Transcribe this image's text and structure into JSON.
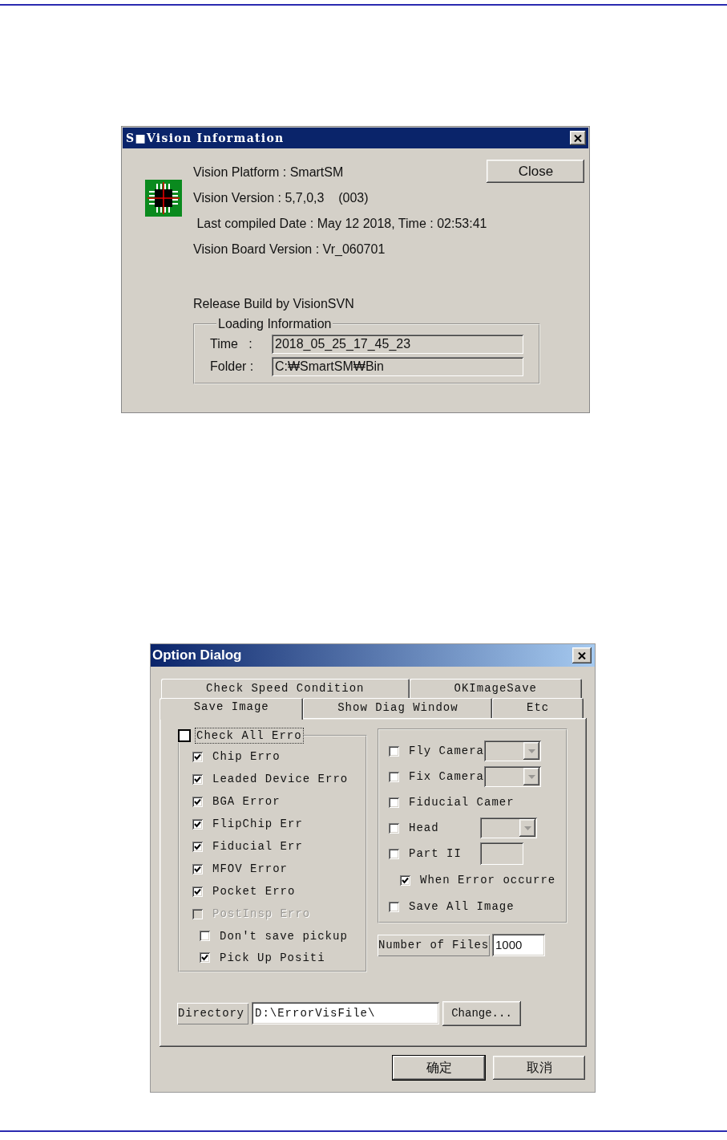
{
  "info_dialog": {
    "title": "S■Vision Information",
    "close_button": "Close",
    "lines": [
      "Vision Platform : SmartSM",
      "Vision Version : 5,7,0,3    (003)",
      " Last compiled Date : May 12 2018, Time : 02:53:41",
      "Vision Board Version : Vr_060701"
    ],
    "release_note": "Release Build by VisionSVN",
    "loading": {
      "title": "Loading Information",
      "fields": [
        {
          "label": "Time   :",
          "value": "2018_05_25_17_45_23"
        },
        {
          "label": "Folder :",
          "value": "C:₩SmartSM₩Bin"
        }
      ]
    }
  },
  "option_dialog": {
    "title": "Option Dialog",
    "tab_rows": [
      {
        "tabs": [
          {
            "label": "Check Speed Condition",
            "selected": false
          },
          {
            "label": "OKImageSave",
            "selected": false
          }
        ]
      },
      {
        "tabs": [
          {
            "label": "Save Image",
            "selected": true
          },
          {
            "label": "Show Diag Window",
            "selected": false
          },
          {
            "label": "Etc",
            "selected": false
          }
        ]
      }
    ],
    "error_group": {
      "check_all": {
        "label": "Check All Erro",
        "checked": false
      },
      "items": [
        {
          "label": "Chip Erro",
          "checked": true,
          "disabled": false,
          "kind": "main"
        },
        {
          "label": "Leaded Device Erro",
          "checked": true,
          "disabled": false,
          "kind": "main"
        },
        {
          "label": "BGA Error",
          "checked": true,
          "disabled": false,
          "kind": "main"
        },
        {
          "label": "FlipChip Err",
          "checked": true,
          "disabled": false,
          "kind": "main"
        },
        {
          "label": "Fiducial Err",
          "checked": true,
          "disabled": false,
          "kind": "main"
        },
        {
          "label": "MFOV Error",
          "checked": true,
          "disabled": false,
          "kind": "main"
        },
        {
          "label": "Pocket Erro",
          "checked": true,
          "disabled": false,
          "kind": "main"
        },
        {
          "label": "PostInsp Erro",
          "checked": false,
          "disabled": true,
          "kind": "main"
        },
        {
          "label": "Don't save pickup",
          "checked": false,
          "disabled": false,
          "kind": "sub"
        },
        {
          "label": "Pick Up Positi",
          "checked": true,
          "disabled": false,
          "kind": "sub"
        }
      ]
    },
    "camera_group": {
      "items": [
        {
          "label": "Fly Camera",
          "checked": false,
          "kind": "combo"
        },
        {
          "label": "Fix Camera",
          "checked": false,
          "kind": "combo"
        },
        {
          "label": "Fiducial Camer",
          "checked": false,
          "kind": "plain"
        },
        {
          "label": "Head",
          "checked": false,
          "kind": "combo"
        },
        {
          "label": "Part II",
          "checked": false,
          "kind": "field"
        },
        {
          "label": "When Error occurre",
          "checked": true,
          "kind": "sub"
        },
        {
          "label": "Save All Image",
          "checked": false,
          "kind": "plain"
        }
      ]
    },
    "number_of_files": {
      "label": "Number of Files",
      "value": "1000"
    },
    "directory": {
      "label": "Directory",
      "value": "D:\\ErrorVisFile\\",
      "button": "Change..."
    },
    "buttons": [
      {
        "label": "确定",
        "default": true
      },
      {
        "label": "取消",
        "default": false
      }
    ]
  }
}
